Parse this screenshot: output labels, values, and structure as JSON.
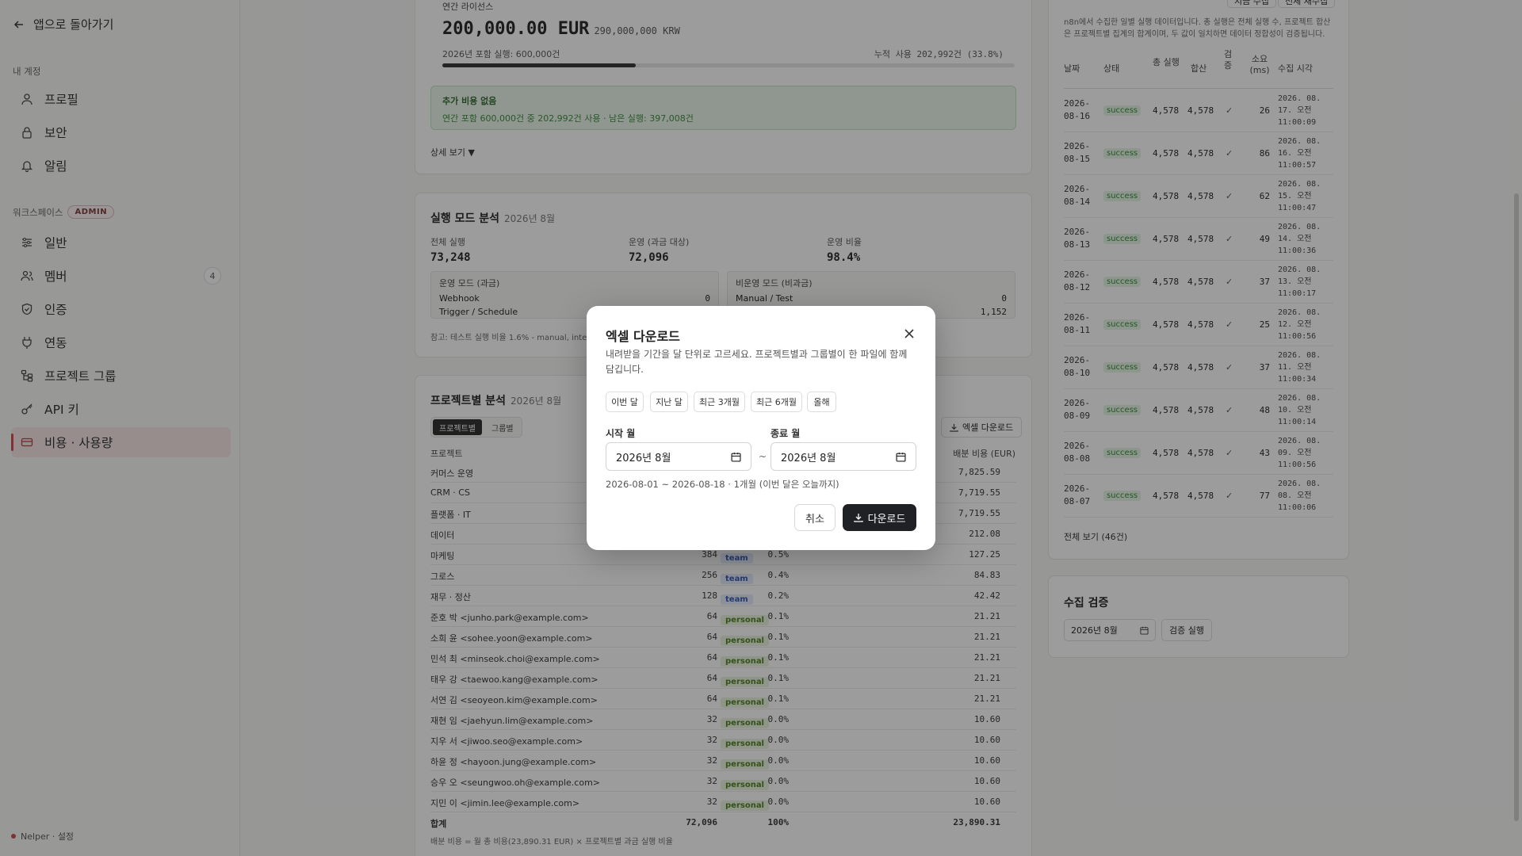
{
  "sidebar": {
    "back_label": "앱으로 돌아가기",
    "section_account": "내 계정",
    "account_items": [
      {
        "label": "프로필"
      },
      {
        "label": "보안"
      },
      {
        "label": "알림"
      }
    ],
    "section_workspace": "워크스페이스",
    "admin_badge": "ADMIN",
    "workspace_items": [
      {
        "label": "일반"
      },
      {
        "label": "멤버",
        "count": "4"
      },
      {
        "label": "인증"
      },
      {
        "label": "연동"
      },
      {
        "label": "프로젝트 그룹"
      },
      {
        "label": "API 키"
      },
      {
        "label": "비용 · 사용량",
        "active": true
      }
    ],
    "footer": "Nelper · 설정"
  },
  "license": {
    "title": "연간 라이선스",
    "amount_eur": "200,000.00 EUR",
    "amount_krw": "290,000,000 KRW",
    "included": "2026년 포함 실행: 600,000건",
    "used": "누적 사용 202,992건 (33.8%)",
    "used_fraction": 0.338,
    "notice_title": "추가 비용 없음",
    "notice_text": "연간 포함 600,000건 중 202,992건 사용 · 남은 실행: 397,008건",
    "details_toggle": "상세 보기 ▼"
  },
  "mode": {
    "title": "실행 모드 분석",
    "period": "2026년 8월",
    "total_label": "전체 실행",
    "total_value": "73,248",
    "billable_label": "운영 (과금 대상)",
    "billable_value": "72,096",
    "ratio_label": "운영 비율",
    "ratio_value": "98.4%",
    "billable_box": {
      "title": "운영 모드 (과금)",
      "rows": [
        {
          "k": "Webhook",
          "v": "0"
        },
        {
          "k": "Trigger / Schedule",
          "v": ""
        }
      ]
    },
    "nonbillable_box": {
      "title": "비운영 모드 (비과금)",
      "rows": [
        {
          "k": "Manual / Test",
          "v": "0"
        },
        {
          "k": "",
          "v": "1,152"
        }
      ]
    },
    "note": "참고: 테스트 실행 비율 1.6% - manual, internal 5"
  },
  "projects": {
    "title": "프로젝트별 분석",
    "period": "2026년 8월",
    "tabs": [
      "프로젝트별",
      "그룹별"
    ],
    "export_label": "엑셀 다운로드",
    "col_project": "프로젝트",
    "col_cost": "배분 비용 (EUR)",
    "rows": [
      {
        "name": "커머스 운영",
        "type": "",
        "count": "",
        "pct": "",
        "cost": "7,825.59"
      },
      {
        "name": "CRM · CS",
        "type": "",
        "count": "",
        "pct": "",
        "cost": "7,719.55"
      },
      {
        "name": "플랫폼 · IT",
        "type": "",
        "count": "",
        "pct": "",
        "cost": "7,719.55"
      },
      {
        "name": "데이터",
        "type": "",
        "count": "",
        "pct": "",
        "cost": "212.08"
      },
      {
        "name": "마케팅",
        "type": "team",
        "count": "384",
        "pct": "0.5%",
        "cost": "127.25"
      },
      {
        "name": "그로스",
        "type": "team",
        "count": "256",
        "pct": "0.4%",
        "cost": "84.83"
      },
      {
        "name": "재무 · 정산",
        "type": "team",
        "count": "128",
        "pct": "0.2%",
        "cost": "42.42"
      },
      {
        "name": "준호 박 <junho.park@example.com>",
        "type": "personal",
        "count": "64",
        "pct": "0.1%",
        "cost": "21.21"
      },
      {
        "name": "소희 윤 <sohee.yoon@example.com>",
        "type": "personal",
        "count": "64",
        "pct": "0.1%",
        "cost": "21.21"
      },
      {
        "name": "민석 최 <minseok.choi@example.com>",
        "type": "personal",
        "count": "64",
        "pct": "0.1%",
        "cost": "21.21"
      },
      {
        "name": "태우 강 <taewoo.kang@example.com>",
        "type": "personal",
        "count": "64",
        "pct": "0.1%",
        "cost": "21.21"
      },
      {
        "name": "서연 김 <seoyeon.kim@example.com>",
        "type": "personal",
        "count": "64",
        "pct": "0.1%",
        "cost": "21.21"
      },
      {
        "name": "재현 임 <jaehyun.lim@example.com>",
        "type": "personal",
        "count": "32",
        "pct": "0.0%",
        "cost": "10.60"
      },
      {
        "name": "지우 서 <jiwoo.seo@example.com>",
        "type": "personal",
        "count": "32",
        "pct": "0.0%",
        "cost": "10.60"
      },
      {
        "name": "하윤 정 <hayoon.jung@example.com>",
        "type": "personal",
        "count": "32",
        "pct": "0.0%",
        "cost": "10.60"
      },
      {
        "name": "승우 오 <seungwoo.oh@example.com>",
        "type": "personal",
        "count": "32",
        "pct": "0.0%",
        "cost": "10.60"
      },
      {
        "name": "지민 이 <jimin.lee@example.com>",
        "type": "personal",
        "count": "32",
        "pct": "0.0%",
        "cost": "10.60"
      }
    ],
    "total": {
      "name": "합계",
      "count": "72,096",
      "pct": "100%",
      "cost": "23,890.31"
    },
    "footnote": "배분 비용 = 월 총 비용(23,890.31 EUR) × 프로젝트별 과금 실행 비율"
  },
  "collection": {
    "top_buttons": [
      "지금 수집",
      "전체 재수집"
    ],
    "desc": "n8n에서 수집한 일별 실행 데이터입니다. 총 실행은 전체 실행 수, 프로젝트 합산은 프로젝트별 집계의 합계이며, 두 값이 일치하면 데이터 정합성이 검증됩니다.",
    "cols": [
      "날짜",
      "상태",
      "총 실행",
      "합산",
      "검증",
      "소요 (ms)",
      "수집 시각"
    ],
    "rows": [
      {
        "date": "2026-08-16",
        "status": "success",
        "total": "4,578",
        "sum": "4,578",
        "check": "✓",
        "ms": "26",
        "time": "2026. 08. 17. 오전 11:00:09"
      },
      {
        "date": "2026-08-15",
        "status": "success",
        "total": "4,578",
        "sum": "4,578",
        "check": "✓",
        "ms": "86",
        "time": "2026. 08. 16. 오전 11:00:57"
      },
      {
        "date": "2026-08-14",
        "status": "success",
        "total": "4,578",
        "sum": "4,578",
        "check": "✓",
        "ms": "62",
        "time": "2026. 08. 15. 오전 11:00:47"
      },
      {
        "date": "2026-08-13",
        "status": "success",
        "total": "4,578",
        "sum": "4,578",
        "check": "✓",
        "ms": "49",
        "time": "2026. 08. 14. 오전 11:00:36"
      },
      {
        "date": "2026-08-12",
        "status": "success",
        "total": "4,578",
        "sum": "4,578",
        "check": "✓",
        "ms": "37",
        "time": "2026. 08. 13. 오전 11:00:17"
      },
      {
        "date": "2026-08-11",
        "status": "success",
        "total": "4,578",
        "sum": "4,578",
        "check": "✓",
        "ms": "25",
        "time": "2026. 08. 12. 오전 11:00:56"
      },
      {
        "date": "2026-08-10",
        "status": "success",
        "total": "4,578",
        "sum": "4,578",
        "check": "✓",
        "ms": "37",
        "time": "2026. 08. 11. 오전 11:00:34"
      },
      {
        "date": "2026-08-09",
        "status": "success",
        "total": "4,578",
        "sum": "4,578",
        "check": "✓",
        "ms": "48",
        "time": "2026. 08. 10. 오전 11:00:14"
      },
      {
        "date": "2026-08-08",
        "status": "success",
        "total": "4,578",
        "sum": "4,578",
        "check": "✓",
        "ms": "43",
        "time": "2026. 08. 09. 오전 11:00:56"
      },
      {
        "date": "2026-08-07",
        "status": "success",
        "total": "4,578",
        "sum": "4,578",
        "check": "✓",
        "ms": "77",
        "time": "2026. 08. 08. 오전 11:00:06"
      }
    ],
    "view_all": "전체 보기 (46건)"
  },
  "verify": {
    "title": "수집 검증",
    "month": "2026년 8월",
    "run_label": "검증 실행"
  },
  "modal": {
    "title": "엑셀 다운로드",
    "desc": "내려받을 기간을 달 단위로 고르세요. 프로젝트별과 그룹별이 한 파일에 함께 담깁니다.",
    "presets": [
      "이번 달",
      "지난 달",
      "최근 3개월",
      "최근 6개월",
      "올해"
    ],
    "start_label": "시작 월",
    "start_value": "2026년 8월",
    "end_label": "종료 월",
    "end_value": "2026년 8월",
    "tilde": "~",
    "range_text": "2026-08-01 ~ 2026-08-18 · 1개월 (이번 달은 오늘까지)",
    "cancel": "취소",
    "download": "다운로드"
  }
}
